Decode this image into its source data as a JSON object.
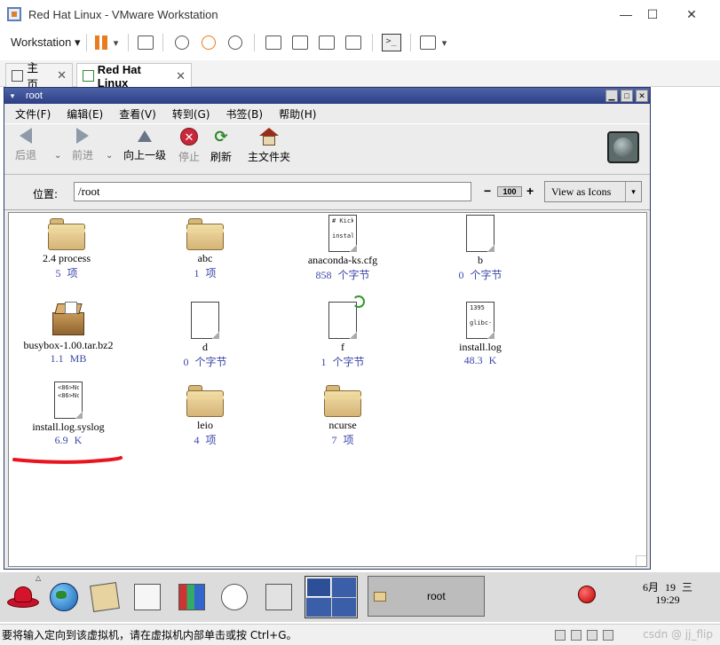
{
  "vmware": {
    "window_title": "Red Hat Linux - VMware Workstation",
    "minimize": "—",
    "maximize": "☐",
    "close": "✕",
    "toolbar": {
      "workstation_menu": "Workstation ▾",
      "pause_caret": "▾",
      "fullscreen_caret": "▾",
      "console_glyph": ">_"
    },
    "tabs": [
      {
        "label": "主页"
      },
      {
        "label": "Red Hat Linux"
      }
    ],
    "tab_close": "✕",
    "status_message": "要将输入定向到该虚拟机，请在虚拟机内部单击或按 Ctrl+G。",
    "watermark": "csdn @ jj_flip"
  },
  "nautilus": {
    "window_title": "root",
    "window_buttons": {
      "minimize": "▁",
      "maximize": "□",
      "close": "✕",
      "menu": "▾"
    },
    "menu": [
      "文件(F)",
      "编辑(E)",
      "查看(V)",
      "转到(G)",
      "书签(B)",
      "帮助(H)"
    ],
    "toolbar": {
      "back": "后退",
      "forward": "前进",
      "up": "向上一级",
      "stop": "停止",
      "reload": "刷新",
      "home": "主文件夹",
      "caret": "⌄"
    },
    "location_label": "位置:",
    "location_value": "/root",
    "zoom": {
      "minus": "−",
      "value": "100",
      "plus": "+"
    },
    "view_as": "View as Icons",
    "view_as_arrow": "▾",
    "files": [
      {
        "name": "2.4 process",
        "info": "5 项",
        "type": "folder"
      },
      {
        "name": "abc",
        "info": "1 项",
        "type": "folder"
      },
      {
        "name": "anaconda-ks.cfg",
        "info": "858 个字节",
        "type": "text",
        "preview": [
          "# Kick",
          "install"
        ]
      },
      {
        "name": "b",
        "info": "0 个字节",
        "type": "blank"
      },
      {
        "name": "busybox-1.00.tar.bz2",
        "info": "1.1 MB",
        "type": "package"
      },
      {
        "name": "d",
        "info": "0 个字节",
        "type": "blank"
      },
      {
        "name": "f",
        "info": "1 个字节",
        "type": "link"
      },
      {
        "name": "install.log",
        "info": "48.3 K",
        "type": "text",
        "preview": [
          "1395",
          "glibc-"
        ]
      },
      {
        "name": "install.log.syslog",
        "info": "6.9 K",
        "type": "text",
        "preview": [
          "<86>Nc",
          "<86>Nc"
        ]
      },
      {
        "name": "leio",
        "info": "4 项",
        "type": "folder"
      },
      {
        "name": "ncurse",
        "info": "7 项",
        "type": "folder"
      }
    ]
  },
  "panel": {
    "task_label": "root",
    "clock_date": "6月 19 三",
    "clock_time": "19:29",
    "alert_glyph": "△"
  },
  "colors": {
    "annotation_underline": "#e8141e",
    "info_text": "#3a46a8",
    "title_gradient": "#2c3e84"
  }
}
